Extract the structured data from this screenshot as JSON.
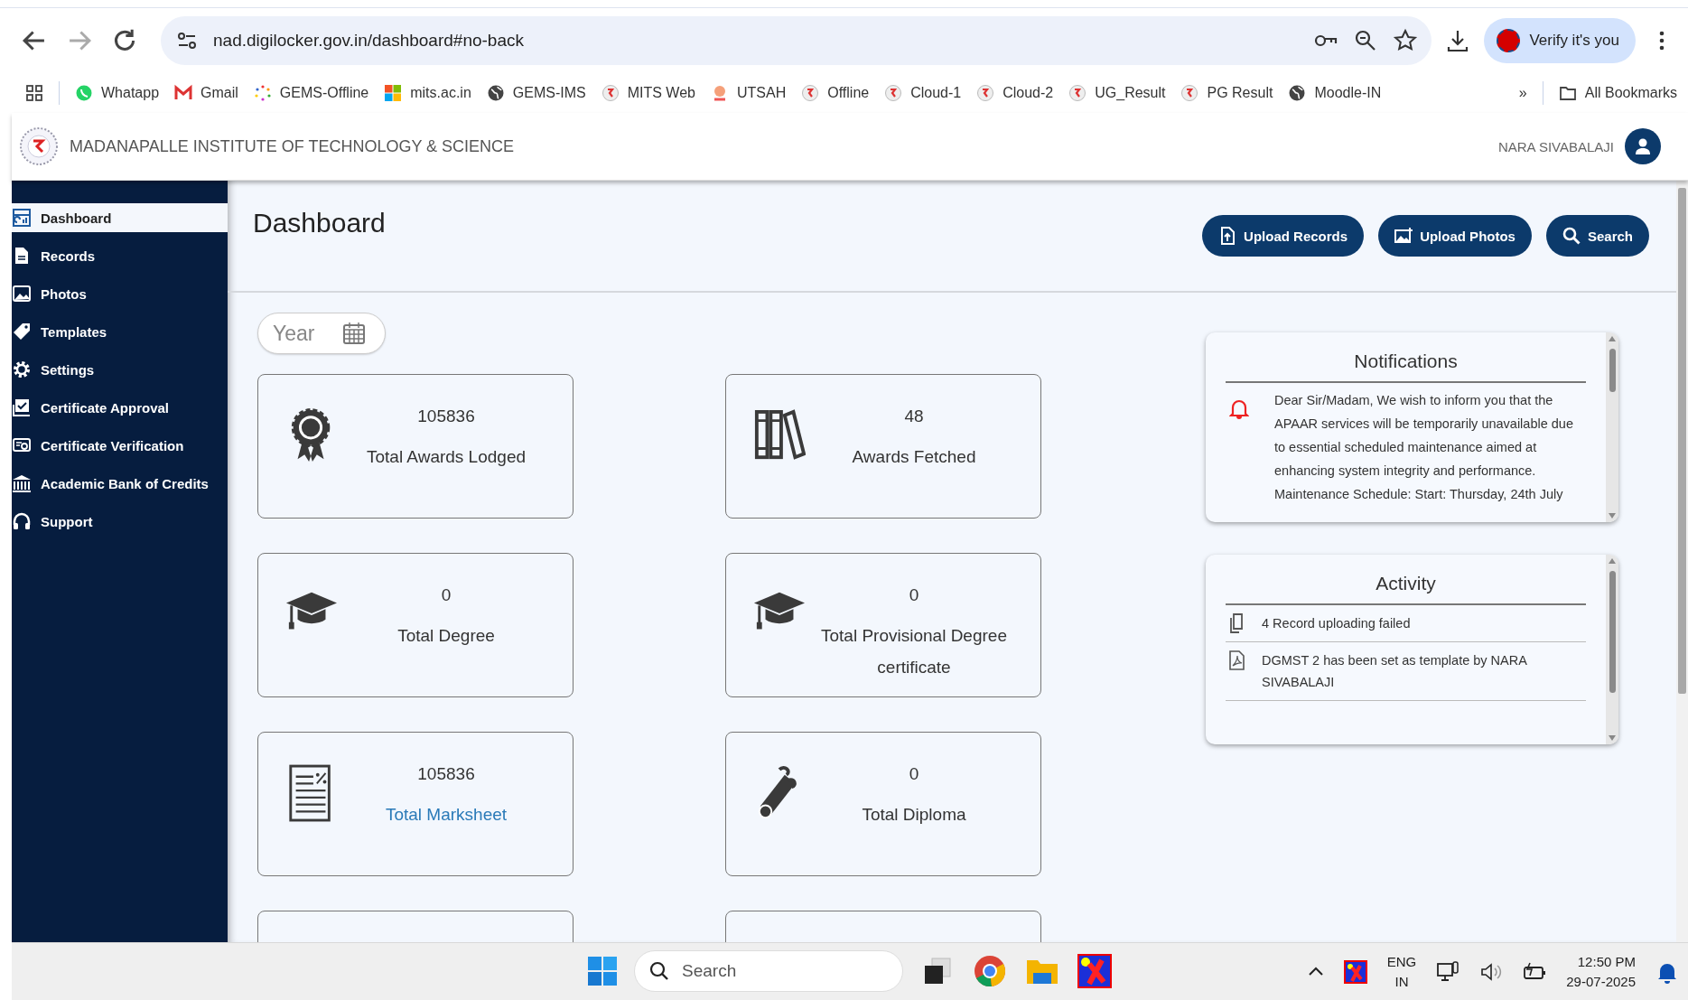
{
  "browser": {
    "url": "nad.digilocker.gov.in/dashboard#no-back",
    "profile_button": "Verify it's you",
    "bookmarks": [
      {
        "label": "Whatapp",
        "kind": "chat"
      },
      {
        "label": "Gmail",
        "kind": "mail"
      },
      {
        "label": "GEMS-Offline",
        "kind": "dots"
      },
      {
        "label": "mits.ac.in",
        "kind": "tiles"
      },
      {
        "label": "GEMS-IMS",
        "kind": "globe"
      },
      {
        "label": "MITS Web",
        "kind": "seal"
      },
      {
        "label": "UTSAH",
        "kind": "badge"
      },
      {
        "label": "Offline",
        "kind": "seal"
      },
      {
        "label": "Cloud-1",
        "kind": "seal"
      },
      {
        "label": "Cloud-2",
        "kind": "seal"
      },
      {
        "label": "UG_Result",
        "kind": "seal"
      },
      {
        "label": "PG Result",
        "kind": "seal"
      },
      {
        "label": "Moodle-IN",
        "kind": "globe"
      }
    ],
    "more": "»",
    "all_bookmarks": "All Bookmarks"
  },
  "header": {
    "institute": "MADANAPALLE INSTITUTE OF TECHNOLOGY & SCIENCE",
    "user": "NARA SIVABALAJI"
  },
  "sidebar": {
    "items": [
      {
        "label": "Dashboard",
        "selected": true
      },
      {
        "label": "Records",
        "selected": false
      },
      {
        "label": "Photos",
        "selected": false
      },
      {
        "label": "Templates",
        "selected": false
      },
      {
        "label": "Settings",
        "selected": false
      },
      {
        "label": "Certificate Approval",
        "selected": false
      },
      {
        "label": "Certificate Verification",
        "selected": false
      },
      {
        "label": "Academic Bank of Credits",
        "selected": false
      },
      {
        "label": "Support",
        "selected": false
      }
    ]
  },
  "page": {
    "title": "Dashboard",
    "actions": [
      {
        "label": "Upload Records",
        "kind": "upload"
      },
      {
        "label": "Upload Photos",
        "kind": "photo"
      },
      {
        "label": "Search",
        "kind": "search"
      }
    ],
    "year_filter": {
      "placeholder": "Year"
    },
    "stats": [
      {
        "kind": "award",
        "value": "105836",
        "label": "Total Awards Lodged",
        "link": false
      },
      {
        "kind": "books",
        "value": "48",
        "label": "Awards Fetched",
        "link": false
      },
      {
        "kind": "degree",
        "value": "0",
        "label": "Total Degree",
        "link": false
      },
      {
        "kind": "degree",
        "value": "0",
        "label": "Total Provisional Degree certificate",
        "link": false
      },
      {
        "kind": "marksheet",
        "value": "105836",
        "label": "Total Marksheet",
        "link": true
      },
      {
        "kind": "diploma",
        "value": "0",
        "label": "Total Diploma",
        "link": false
      },
      {
        "kind": "clipped"
      },
      {
        "kind": "clipped"
      }
    ],
    "notifications": {
      "title": "Notifications",
      "items": [
        {
          "text": "Dear Sir/Madam, We wish to inform you that the APAAR services will be temporarily unavailable due to essential scheduled maintenance aimed at enhancing system integrity and performance. Maintenance Schedule: Start: Thursday, 24th July"
        }
      ]
    },
    "activity": {
      "title": "Activity",
      "items": [
        {
          "kind": "copy",
          "text": "4 Record uploading failed"
        },
        {
          "kind": "pdf",
          "text": "DGMST 2 has been set as template by NARA SIVABALAJI"
        }
      ]
    }
  },
  "taskbar": {
    "search_placeholder": "Search",
    "language": "ENG",
    "region": "IN",
    "time": "12:50 PM",
    "date": "29-07-2025"
  }
}
